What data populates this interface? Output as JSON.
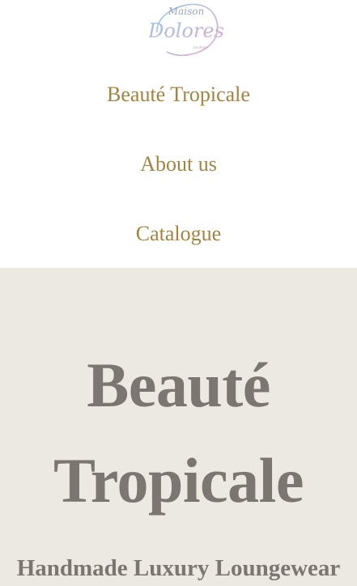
{
  "logo": {
    "text_top": "Maison",
    "text_main": "Dolores",
    "text_small": "boutique"
  },
  "nav": {
    "items": [
      {
        "label": "Beauté Tropicale"
      },
      {
        "label": "About us"
      },
      {
        "label": "Catalogue"
      }
    ]
  },
  "hero": {
    "title_line1": "Beauté",
    "title_line2": "Tropicale",
    "subtitle": "Handmade Luxury Loungewear"
  },
  "colors": {
    "nav_link": "#a3843e",
    "hero_bg": "#ece8e2",
    "hero_text": "#7c7672",
    "logo_gradient_start": "#8ec9e6",
    "logo_gradient_end": "#e6a8cf"
  }
}
